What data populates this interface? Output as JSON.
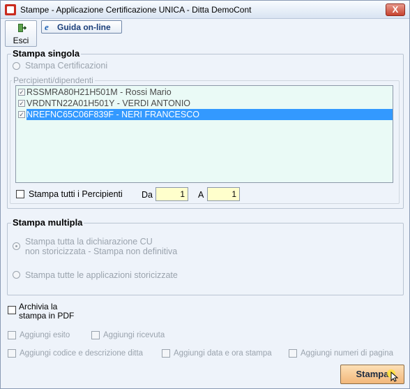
{
  "window": {
    "title": "Stampe - Applicazione Certificazione UNICA - Ditta  DemoCont",
    "close_label": "X"
  },
  "toolbar": {
    "esci_label": "Esci",
    "guida_label": "Guida on-line",
    "guida_icon": "e"
  },
  "stampa_singola": {
    "title": "Stampa singola",
    "radio_label": "Stampa Certificazioni",
    "subgroup_title": "Percipienti/dipendenti",
    "rows": [
      {
        "text": "RSSMRA80H21H501M - Rossi Mario",
        "checked": true,
        "selected": false
      },
      {
        "text": "VRDNTN22A01H501Y - VERDI ANTONIO",
        "checked": true,
        "selected": false
      },
      {
        "text": "NREFNC65C06F839F - NERI FRANCESCO",
        "checked": true,
        "selected": true
      }
    ],
    "all_label": "Stampa tutti i Percipienti",
    "da_label": "Da",
    "da_value": "1",
    "a_label": "A",
    "a_value": "1"
  },
  "stampa_multipla": {
    "title": "Stampa multipla",
    "option1_line1": "Stampa tutta la dichiarazione CU",
    "option1_line2": "non storicizzata - Stampa non definitiva",
    "option2": "Stampa tutte le applicazioni storicizzate"
  },
  "options": {
    "archivia_line1": "Archivia la",
    "archivia_line2": "stampa in PDF",
    "aggiungi_esito": "Aggiungi esito",
    "aggiungi_ricevuta": "Aggiungi ricevuta",
    "aggiungi_codice": "Aggiungi codice e descrizione ditta",
    "aggiungi_data": "Aggiungi data e ora stampa",
    "aggiungi_numeri": "Aggiungi numeri di pagina"
  },
  "actions": {
    "stampa_label": "Stampa"
  },
  "colors": {
    "selection": "#3399ff",
    "input_bg": "#ffffcc",
    "list_bg": "#eafaf6",
    "stampa_button": "#f2b77a"
  }
}
